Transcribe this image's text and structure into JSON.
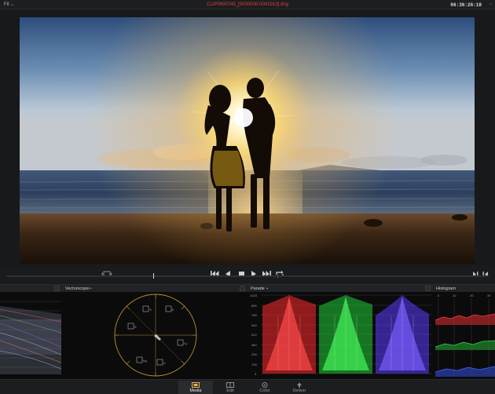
{
  "topbar": {
    "fit_label": "Fit",
    "filename": "CLIP0000745_[0000000-0001913].dng",
    "timecode": "06:36:26:18"
  },
  "scopes": {
    "vectorscope_label": "Vectorscope",
    "parade_label": "Parade",
    "histogram_label": "Histogram",
    "parade_ticks": [
      "1023",
      "896",
      "768",
      "640",
      "512",
      "384",
      "256",
      "128",
      "0"
    ],
    "histogram_ticks": [
      "0",
      "10",
      "20",
      "30"
    ],
    "vector_targets": [
      "R",
      "Mg",
      "B",
      "Cy",
      "G",
      "Yl"
    ]
  },
  "pages": {
    "items": [
      {
        "label": "Media",
        "icon": "media-icon"
      },
      {
        "label": "Edit",
        "icon": "edit-icon"
      },
      {
        "label": "Color",
        "icon": "color-icon"
      },
      {
        "label": "Deliver",
        "icon": "deliver-icon"
      }
    ],
    "active": "Media"
  },
  "colors": {
    "accent_red": "#e0403a",
    "parade_red": "#ff2a2a",
    "parade_green": "#21e03a",
    "parade_blue": "#5b3cff",
    "vectorscope_gold": "#b8902e"
  }
}
